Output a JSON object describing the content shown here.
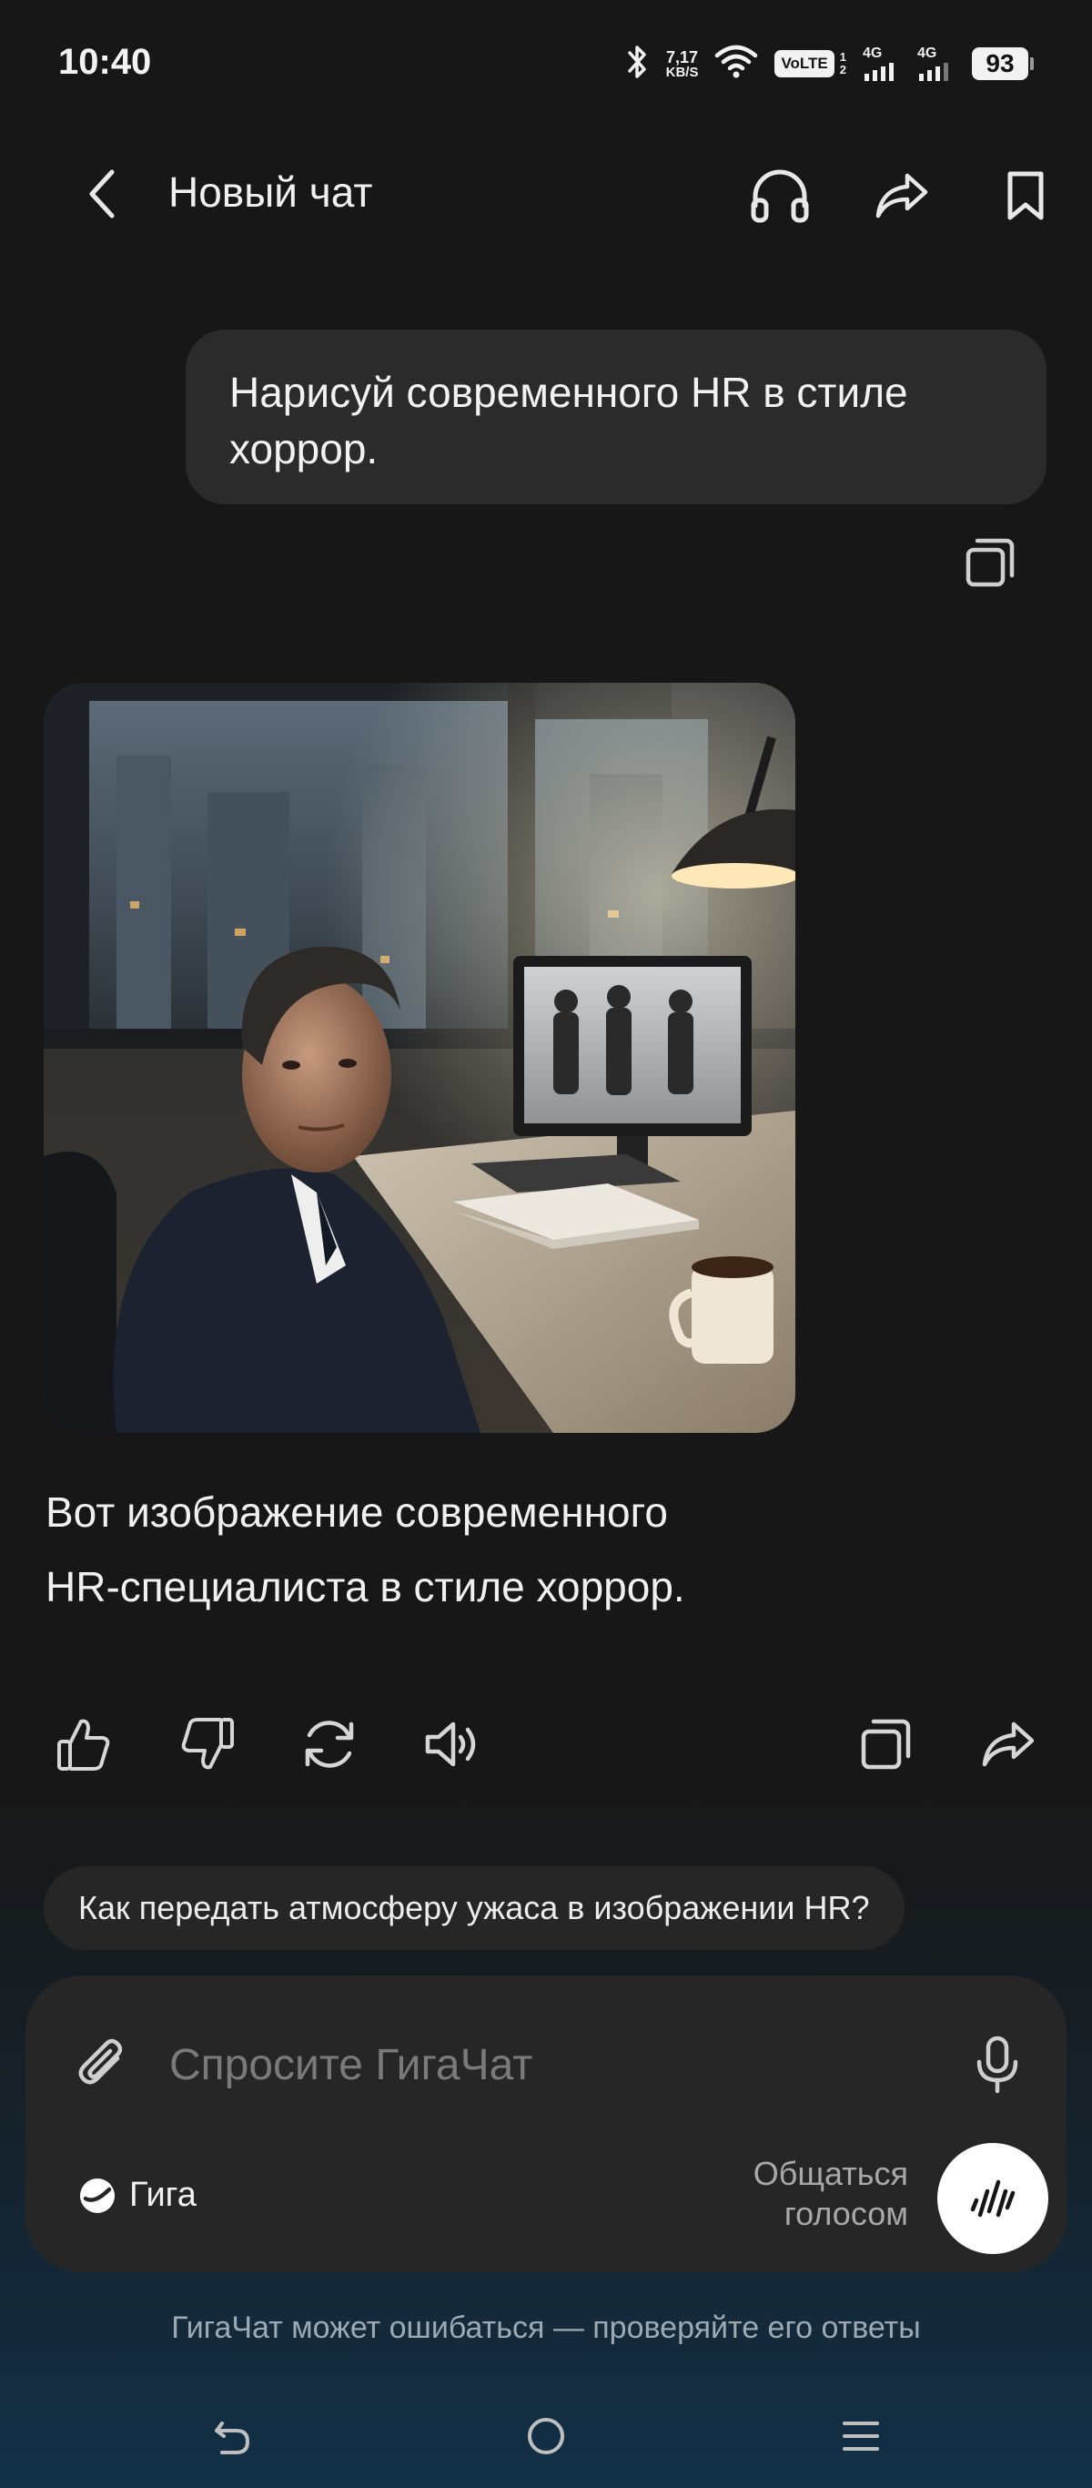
{
  "status_bar": {
    "time": "10:40",
    "speed_value": "7,17",
    "speed_unit": "KB/S",
    "volte": "VoLTE",
    "sim1": "1",
    "sim2": "2",
    "net1": "4G",
    "net2": "4G",
    "battery": "93"
  },
  "header": {
    "title": "Новый чат",
    "icons": [
      "back-arrow-icon",
      "headphones-icon",
      "share-icon",
      "bookmark-icon"
    ]
  },
  "user_message": {
    "text": "Нарисуй современного HR в стиле хоррор."
  },
  "assistant_message": {
    "image": "generated-hr-horror-image",
    "line1": "Вот изображение современного",
    "line2": "HR-специалиста в стиле хоррор."
  },
  "actions": [
    "thumbs-up-icon",
    "thumbs-down-icon",
    "regenerate-icon",
    "speaker-icon",
    "copy-icon",
    "share-icon"
  ],
  "suggestion": {
    "text": "Как передать атмосферу ужаса в изображении HR?"
  },
  "composer": {
    "placeholder": "Спросите ГигаЧат",
    "model_label": "Гига",
    "voice_line1": "Общаться",
    "voice_line2": "голосом"
  },
  "disclaimer": "ГигаЧат может ошибаться — проверяйте его ответы",
  "colors": {
    "background": "#171717",
    "bubble": "#2b2b2b",
    "composer": "#262626",
    "voice_button": "#ffffff"
  }
}
